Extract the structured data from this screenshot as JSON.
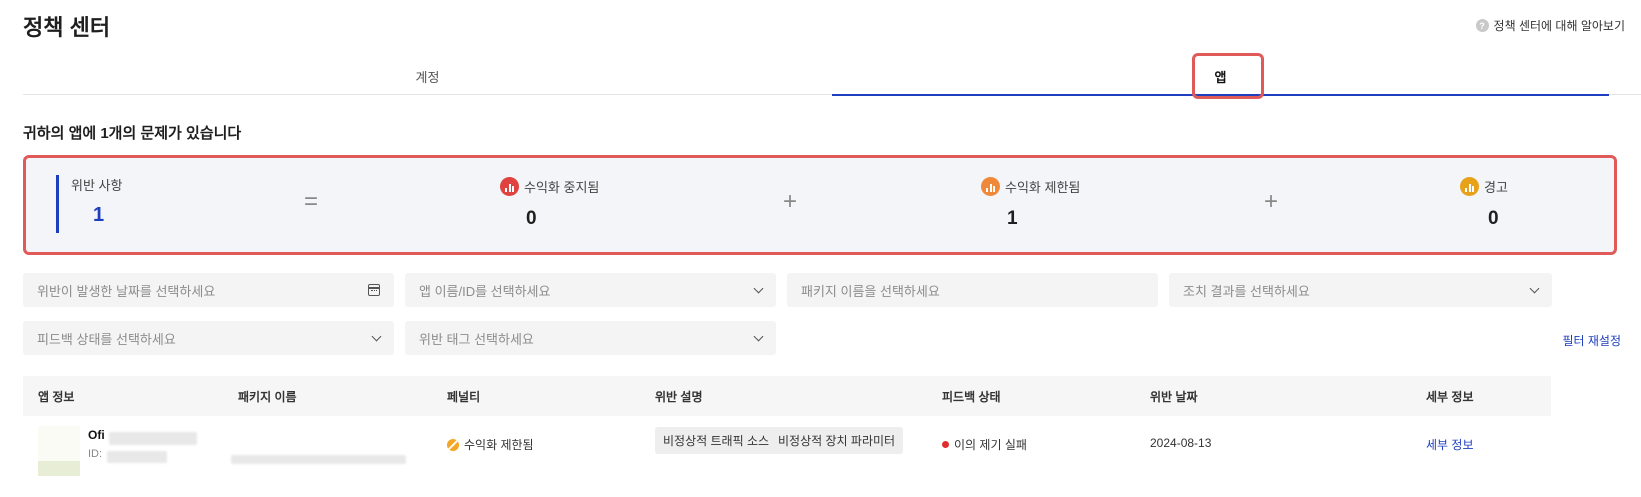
{
  "header": {
    "title": "정책 센터",
    "help_icon_glyph": "?",
    "help_link": "정책 센터에 대해 알아보기"
  },
  "tabs": [
    {
      "label": "계정",
      "active": false
    },
    {
      "label": "앱",
      "active": true
    }
  ],
  "issues_heading": "귀하의 앱에 1개의 문제가 있습니다",
  "summary": {
    "total_label": "위반 사항",
    "total_value": "1",
    "equals_symbol": "=",
    "plus_symbol": "+",
    "items": [
      {
        "label": "수익화 중지됨",
        "value": "0",
        "icon": "bar-chart-icon",
        "color": "#e0433f"
      },
      {
        "label": "수익화 제한됨",
        "value": "1",
        "icon": "bar-chart-icon",
        "color": "#f0883a"
      },
      {
        "label": "경고",
        "value": "0",
        "icon": "bar-chart-icon",
        "color": "#e8a21a"
      }
    ]
  },
  "filters": {
    "date_placeholder": "위반이 발생한 날짜를 선택하세요",
    "app_placeholder": "앱 이름/ID를 선택하세요",
    "package_placeholder": "패키지 이름을 선택하세요",
    "action_placeholder": "조치 결과를 선택하세요",
    "feedback_placeholder": "피드백 상태를 선택하세요",
    "tag_placeholder": "위반 태그 선택하세요",
    "reset_label": "필터 재설정"
  },
  "table": {
    "columns": [
      "앱 정보",
      "패키지 이름",
      "페널티",
      "위반 설명",
      "피드백 상태",
      "위반 날짜",
      "세부 정보"
    ],
    "rows": [
      {
        "app_name": "Ofi",
        "app_id_prefix": "ID:",
        "penalty": "수익화 제한됨",
        "violations": [
          "비정상적 트래픽 소스",
          "비정상적 장치 파라미터"
        ],
        "feedback": "이의 제기 실패",
        "date": "2024-08-13",
        "details": "세부 정보"
      }
    ]
  },
  "colors": {
    "accent": "#1d3fbf",
    "highlight": "#e05a5a",
    "status_failed": "#e02e2e"
  }
}
